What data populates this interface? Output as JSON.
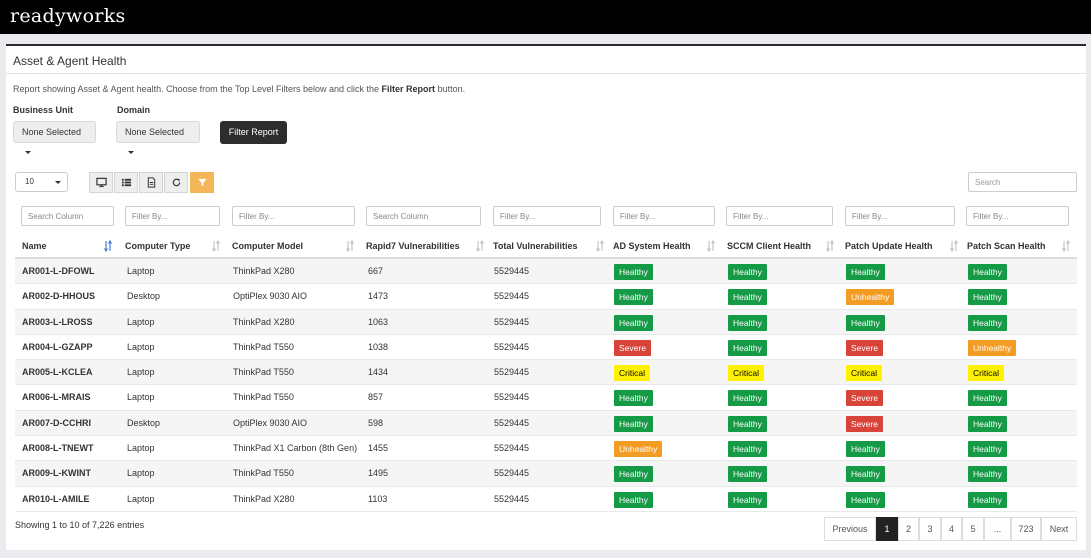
{
  "header": {
    "logo": "readyworks"
  },
  "panel": {
    "title": "Asset & Agent Health",
    "description_pre": "Report showing Asset & Agent health. Choose from the Top Level Filters below and click the ",
    "description_bold": "Filter Report",
    "description_post": " button."
  },
  "filters": {
    "business_unit": {
      "label": "Business Unit",
      "value": "None Selected"
    },
    "domain": {
      "label": "Domain",
      "value": "None Selected"
    },
    "submit_label": "Filter Report"
  },
  "toolbar": {
    "page_length": "10",
    "icons": [
      "monitor-icon",
      "list-icon",
      "export-file-icon",
      "refresh-icon",
      "filter-icon"
    ],
    "search_placeholder": "Search"
  },
  "table": {
    "columns": [
      {
        "label": "Name",
        "filter_placeholder": "Search Column",
        "sorted": "asc"
      },
      {
        "label": "Computer Type",
        "filter_placeholder": "Filter By..."
      },
      {
        "label": "Computer Model",
        "filter_placeholder": "Filter By..."
      },
      {
        "label": "Rapid7 Vulnerabilities",
        "filter_placeholder": "Search Column"
      },
      {
        "label": "Total Vulnerabilities",
        "filter_placeholder": "Filter By..."
      },
      {
        "label": "AD System Health",
        "filter_placeholder": "Filter By..."
      },
      {
        "label": "SCCM Client Health",
        "filter_placeholder": "Filter By..."
      },
      {
        "label": "Patch Update Health",
        "filter_placeholder": "Filter By..."
      },
      {
        "label": "Patch Scan Health",
        "filter_placeholder": "Filter By..."
      }
    ],
    "rows": [
      [
        "AR001-L-DFOWL",
        "Laptop",
        "ThinkPad X280",
        "667",
        "5529445",
        "Healthy",
        "Healthy",
        "Healthy",
        "Healthy"
      ],
      [
        "AR002-D-HHOUS",
        "Desktop",
        "OptiPlex 9030 AIO",
        "1473",
        "5529445",
        "Healthy",
        "Healthy",
        "Unhealthy",
        "Healthy"
      ],
      [
        "AR003-L-LROSS",
        "Laptop",
        "ThinkPad X280",
        "1063",
        "5529445",
        "Healthy",
        "Healthy",
        "Healthy",
        "Healthy"
      ],
      [
        "AR004-L-GZAPP",
        "Laptop",
        "ThinkPad T550",
        "1038",
        "5529445",
        "Severe",
        "Healthy",
        "Severe",
        "Unhealthy"
      ],
      [
        "AR005-L-KCLEA",
        "Laptop",
        "ThinkPad T550",
        "1434",
        "5529445",
        "Critical",
        "Critical",
        "Critical",
        "Critical"
      ],
      [
        "AR006-L-MRAIS",
        "Laptop",
        "ThinkPad T550",
        "857",
        "5529445",
        "Healthy",
        "Healthy",
        "Severe",
        "Healthy"
      ],
      [
        "AR007-D-CCHRI",
        "Desktop",
        "OptiPlex 9030 AIO",
        "598",
        "5529445",
        "Healthy",
        "Healthy",
        "Severe",
        "Healthy"
      ],
      [
        "AR008-L-TNEWT",
        "Laptop",
        "ThinkPad X1 Carbon (8th Gen)",
        "1455",
        "5529445",
        "Unhealthy",
        "Healthy",
        "Healthy",
        "Healthy"
      ],
      [
        "AR009-L-KWINT",
        "Laptop",
        "ThinkPad T550",
        "1495",
        "5529445",
        "Healthy",
        "Healthy",
        "Healthy",
        "Healthy"
      ],
      [
        "AR010-L-AMILE",
        "Laptop",
        "ThinkPad X280",
        "1103",
        "5529445",
        "Healthy",
        "Healthy",
        "Healthy",
        "Healthy"
      ]
    ],
    "info": "Showing 1 to 10 of 7,226 entries"
  },
  "pagination": {
    "previous": "Previous",
    "pages": [
      "1",
      "2",
      "3",
      "4",
      "5",
      "...",
      "723"
    ],
    "active": "1",
    "next": "Next"
  },
  "colors": {
    "healthy": "#159a46",
    "unhealthy": "#f39c24",
    "severe": "#d9443a",
    "critical": "#fff200",
    "filter_active": "#f5b559"
  }
}
